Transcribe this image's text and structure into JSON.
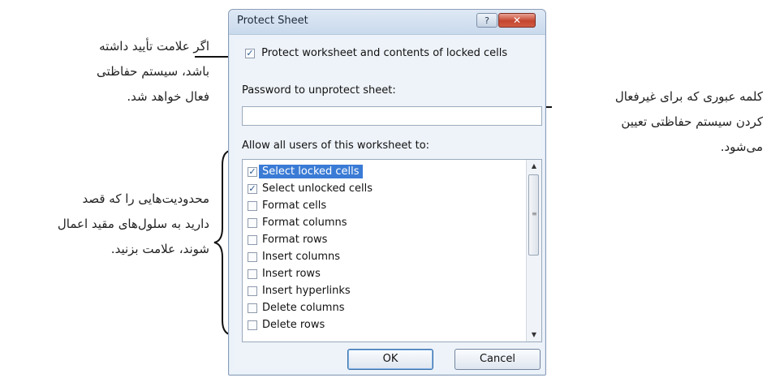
{
  "dialog": {
    "title": "Protect Sheet",
    "help_label": "?",
    "close_label": "✕",
    "protect_checkbox": {
      "checked": true,
      "mark": "✓",
      "label": "Protect worksheet and contents of locked cells"
    },
    "password_label": "Password to unprotect sheet:",
    "password_value": "",
    "allow_label": "Allow all users of this worksheet to:",
    "permissions": [
      {
        "label": "Select locked cells",
        "checked": true,
        "mark": "✓"
      },
      {
        "label": "Select unlocked cells",
        "checked": true,
        "mark": "✓"
      },
      {
        "label": "Format cells",
        "checked": false,
        "mark": ""
      },
      {
        "label": "Format columns",
        "checked": false,
        "mark": ""
      },
      {
        "label": "Format rows",
        "checked": false,
        "mark": ""
      },
      {
        "label": "Insert columns",
        "checked": false,
        "mark": ""
      },
      {
        "label": "Insert rows",
        "checked": false,
        "mark": ""
      },
      {
        "label": "Insert hyperlinks",
        "checked": false,
        "mark": ""
      },
      {
        "label": "Delete columns",
        "checked": false,
        "mark": ""
      },
      {
        "label": "Delete rows",
        "checked": false,
        "mark": ""
      }
    ],
    "scroll_up": "▲",
    "scroll_down": "▼",
    "ok_label": "OK",
    "cancel_label": "Cancel"
  },
  "annotations": {
    "left_top": [
      "اگر علامت تأیید داشته",
      "باشد، سیستم حفاظتی",
      "فعال خواهد شد."
    ],
    "right": [
      "کلمه عبوری که برای غیرفعال",
      "کردن سیستم حفاظتی تعیین",
      "می‌شود."
    ],
    "left_bottom": [
      "محدودیت‌هایی را که قصد",
      "دارید به سلول‌های مقید اعمال",
      "شوند، علامت بزنید."
    ]
  },
  "colors": {
    "selection": "#3a7bd5",
    "close_button": "#c4452f",
    "dialog_bg": "#eef3f9"
  }
}
